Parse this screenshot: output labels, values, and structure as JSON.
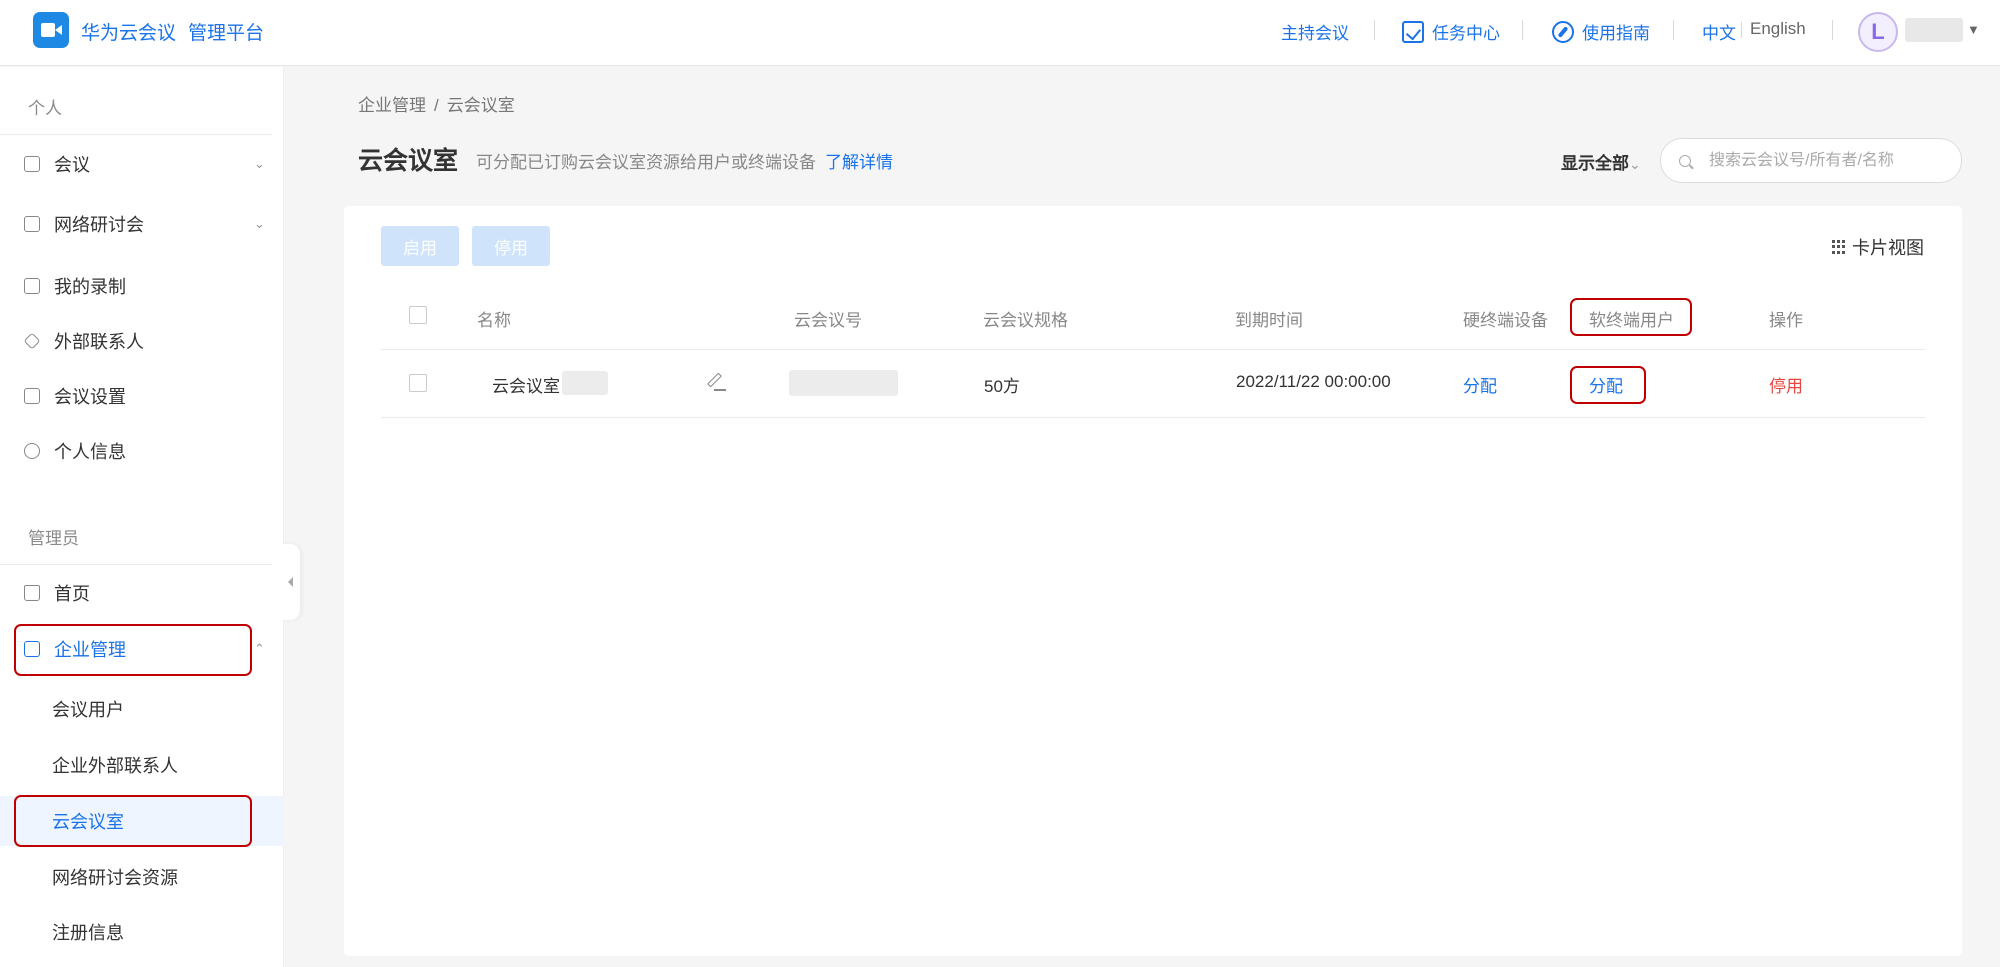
{
  "header": {
    "brand_name": "华为云会议",
    "brand_sub": "管理平台",
    "host_meeting": "主持会议",
    "task_center": "任务中心",
    "user_guide": "使用指南",
    "lang_zh": "中文",
    "lang_en": "English",
    "avatar_letter": "L"
  },
  "sidebar": {
    "personal_title": "个人",
    "personal_items": [
      {
        "label": "会议",
        "icon": "calendar-icon"
      },
      {
        "label": "网络研讨会",
        "icon": "webinar-icon"
      },
      {
        "label": "我的录制",
        "icon": "recording-icon"
      },
      {
        "label": "外部联系人",
        "icon": "contact-icon"
      },
      {
        "label": "会议设置",
        "icon": "settings-icon"
      },
      {
        "label": "个人信息",
        "icon": "user-icon"
      }
    ],
    "admin_title": "管理员",
    "admin_items": [
      {
        "label": "首页",
        "icon": "home-icon"
      },
      {
        "label": "企业管理",
        "icon": "enterprise-icon"
      }
    ],
    "sub_items": [
      "会议用户",
      "企业外部联系人",
      "云会议室",
      "网络研讨会资源",
      "注册信息"
    ]
  },
  "breadcrumb": {
    "parent": "企业管理",
    "current": "云会议室"
  },
  "page": {
    "title": "云会议室",
    "description": "可分配已订购云会议室资源给用户或终端设备",
    "learn_more": "了解详情",
    "filter": "显示全部",
    "search_placeholder": "搜索云会议号/所有者/名称"
  },
  "toolbar": {
    "enable": "启用",
    "disable": "停用",
    "card_view": "卡片视图"
  },
  "table": {
    "headers": [
      "名称",
      "云会议号",
      "云会议规格",
      "到期时间",
      "硬终端设备",
      "软终端用户",
      "操作"
    ],
    "rows": [
      {
        "name": "云会议室",
        "meeting_id": "",
        "spec": "50方",
        "expiry": "2022/11/22 00:00:00",
        "hard_terminal": "分配",
        "soft_terminal": "分配",
        "action": "停用"
      }
    ]
  },
  "colors": {
    "accent": "#1a73e8",
    "highlight": "#c00000",
    "danger": "#e8473f"
  }
}
